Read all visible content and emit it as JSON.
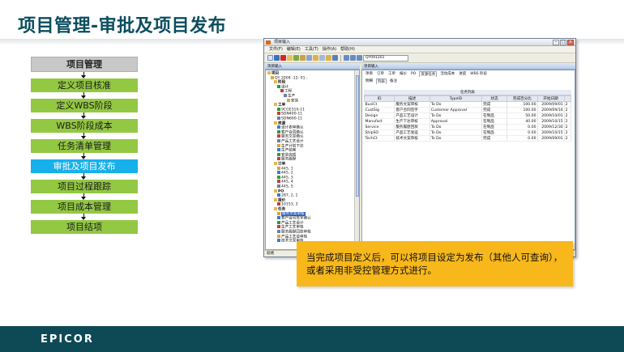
{
  "slide": {
    "title": "项目管理-审批及项目发布",
    "callout": "当完成项目定义后，可以将项目设定为发布（其他人可查询），或者采用非受控管理方式进行。",
    "footer_logo": "EPICOR"
  },
  "flow": {
    "header": "项目管理",
    "steps": [
      "定义项目核准",
      "定义WBS阶段",
      "WBS阶段成本",
      "任务清单管理",
      "审批及项目发布",
      "项目过程跟踪",
      "项目成本管理",
      "项目结项"
    ],
    "active_index": 4,
    "colors": {
      "step": "#93c843",
      "active": "#16b0ea",
      "header": "#c8c8c8"
    }
  },
  "window": {
    "title": "项目输入",
    "menu": [
      "文件(F)",
      "编辑(E)",
      "工具(T)",
      "操作(A)",
      "帮助(H)"
    ],
    "toolbar_input": "QY091201",
    "left_pane_title": "项目输入",
    "right_pane_title": "项目输入",
    "status": "就绪",
    "tree": [
      {
        "label": "项目",
        "bold": true,
        "indent": 0
      },
      {
        "label": "QY 2009 -12- 01 -",
        "bold": false,
        "indent": 1
      },
      {
        "label": "阶段",
        "bold": true,
        "indent": 2
      },
      {
        "label": "设计",
        "bold": false,
        "indent": 3
      },
      {
        "label": "工程",
        "bold": false,
        "indent": 4
      },
      {
        "label": "生产",
        "bold": false,
        "indent": 5
      },
      {
        "label": "安装",
        "bold": false,
        "indent": 6
      },
      {
        "label": "工单",
        "bold": true,
        "indent": 2
      },
      {
        "label": "9CGE310-11",
        "bold": false,
        "indent": 3
      },
      {
        "label": "SDN400-11",
        "bold": false,
        "indent": 3
      },
      {
        "label": "SDN600-11",
        "bold": false,
        "indent": 3
      },
      {
        "label": "资源",
        "bold": true,
        "indent": 2
      },
      {
        "label": "设计表审确认",
        "bold": false,
        "indent": 3
      },
      {
        "label": "客户合同确认",
        "bold": false,
        "indent": 3
      },
      {
        "label": "服务文案确认",
        "bold": false,
        "indent": 3
      },
      {
        "label": "产品工艺设计",
        "bold": false,
        "indent": 3
      },
      {
        "label": "生产计划下达",
        "bold": false,
        "indent": 3
      },
      {
        "label": "生产结束",
        "bold": false,
        "indent": 3
      },
      {
        "label": "安装完成",
        "bold": false,
        "indent": 3
      },
      {
        "label": "服务履歷",
        "bold": false,
        "indent": 3
      },
      {
        "label": "订单",
        "bold": true,
        "indent": 2
      },
      {
        "label": "445, 1",
        "bold": false,
        "indent": 3
      },
      {
        "label": "445, 2",
        "bold": false,
        "indent": 3
      },
      {
        "label": "445, 3",
        "bold": false,
        "indent": 3
      },
      {
        "label": "445, 4",
        "bold": false,
        "indent": 3
      },
      {
        "label": "445, 5",
        "bold": false,
        "indent": 3
      },
      {
        "label": "PO",
        "bold": true,
        "indent": 2
      },
      {
        "label": "287, 2, 1",
        "bold": false,
        "indent": 3
      },
      {
        "label": "报价",
        "bold": true,
        "indent": 2
      },
      {
        "label": "10153, 3",
        "bold": false,
        "indent": 3
      },
      {
        "label": "任务",
        "bold": true,
        "indent": 2
      },
      {
        "label": "服务文案审核",
        "bold": false,
        "indent": 3,
        "selected": true
      },
      {
        "label": "客户合同签字确认",
        "bold": false,
        "indent": 3
      },
      {
        "label": "产品工艺设计",
        "bold": false,
        "indent": 3
      },
      {
        "label": "生产工艺审核",
        "bold": false,
        "indent": 3
      },
      {
        "label": "服务履歷回款审核",
        "bold": false,
        "indent": 3
      },
      {
        "label": "产品工艺设审核",
        "bold": false,
        "indent": 3
      },
      {
        "label": "技术文案审核",
        "bold": false,
        "indent": 3
      }
    ],
    "main_tabs": [
      "项目",
      "订单",
      "工单",
      "报价",
      "PO",
      "资源任务",
      "活动成本",
      "进度",
      "WBS 阶段"
    ],
    "main_tab_active": 5,
    "sub_tabs": [
      "明细",
      "列表",
      "备注"
    ],
    "sub_tab_active": 1,
    "grid_title": "任务列表",
    "columns": [
      "ID",
      "描述",
      "TypeID",
      "状态",
      "完成百分比",
      "开始日期",
      ""
    ],
    "rows": [
      [
        "BusiCt",
        "服务文案审核",
        "To Do",
        "完成",
        "100.00",
        "2009/09/01",
        "2"
      ],
      [
        "CustSig",
        "客户合同签字",
        "Customer Approval",
        "完成",
        "100.00",
        "2009/09/16",
        "2"
      ],
      [
        "Design",
        "产品工艺设计",
        "To Do",
        "在制品",
        "50.00",
        "2009/10/01",
        "2"
      ],
      [
        "Manufact",
        "生产下达审核",
        "Approval",
        "在制品",
        "40.00",
        "2009/10/15",
        "2"
      ],
      [
        "Service",
        "服务履歷回款",
        "To Do",
        "在制品",
        "0.00",
        "2009/12/30",
        "2"
      ],
      [
        "ShipSO",
        "产品工艺发运",
        "To Do",
        "在制品",
        "0.00",
        "2009/10/15",
        "2"
      ],
      [
        "TechCt",
        "技术文案审核",
        "To Do",
        "完成",
        "0.00",
        "2009/09/01",
        "2"
      ]
    ]
  }
}
